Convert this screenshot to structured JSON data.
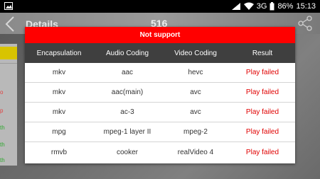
{
  "status_bar": {
    "network": "3G",
    "battery": "86%",
    "time": "15:13",
    "icons": [
      "image-icon",
      "wifi-icon",
      "signal-icon",
      "battery-icon"
    ]
  },
  "background": {
    "title": "Details",
    "count": "516",
    "side_rows": [
      "o",
      "p",
      "th",
      "th",
      "th"
    ]
  },
  "dialog": {
    "title": "Not support",
    "columns": [
      "Encapsulation",
      "Audio Coding",
      "Video Coding",
      "Result"
    ],
    "rows": [
      [
        "mkv",
        "aac",
        "hevc",
        "Play failed"
      ],
      [
        "mkv",
        "aac(main)",
        "avc",
        "Play failed"
      ],
      [
        "mkv",
        "ac-3",
        "avc",
        "Play failed"
      ],
      [
        "mpg",
        "mpeg-1 layer II",
        "mpeg-2",
        "Play failed"
      ],
      [
        "rmvb",
        "cooker",
        "realVideo 4",
        "Play failed"
      ]
    ],
    "colors": {
      "title_bg": "#ff0000",
      "header_bg": "#3f3f3f",
      "fail_text": "#e00000"
    }
  }
}
